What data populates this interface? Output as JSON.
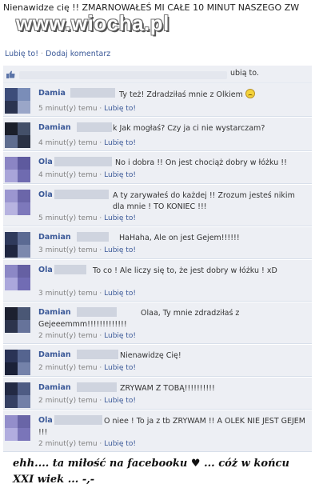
{
  "post": {
    "text": "Nienawidze cię !! ZMARNOWAŁEŚ MI CAŁE 10 MINUT NASZEGO ZW",
    "watermark": "www.wiocha.pl"
  },
  "actions": {
    "like": "Lubię to!",
    "separator": "·",
    "comment": "Dodaj komentarz"
  },
  "likes": {
    "text": "ubią to."
  },
  "comments": [
    {
      "name": "Damia",
      "text": "Ty też! Zdradziłaś mnie z Olkiem",
      "smiley": true,
      "time": "5 minut(y) temu",
      "like": "Lubię to!",
      "colors": [
        "#3d4d7a",
        "#7a8db8",
        "#2b3450",
        "#9aa6c8"
      ]
    },
    {
      "name": "Damian",
      "text": "k Jak mogłaś? Czy ja ci nie wystarczam?",
      "time": "4 minut(y) temu",
      "like": "Lubię to!",
      "colors": [
        "#1b1f2a",
        "#445069",
        "#5f6d8f",
        "#2a3144"
      ]
    },
    {
      "name": "Ola",
      "text": "No i dobra !! On jest chociąż dobry w łóżku !!",
      "time": "4 minut(y) temu",
      "like": "Lubię to!",
      "colors": [
        "#8b85c4",
        "#5e5a9e",
        "#a9a5d9",
        "#6f6bb0"
      ]
    },
    {
      "name": "Ola",
      "text": "A ty zarywałeś do każdej !! Zrozum jesteś nikim dla mnie ! TO KONIEC !!!",
      "time": "5 minut(y) temu",
      "like": "Lubię to!",
      "colors": [
        "#9b96d0",
        "#6b66a9",
        "#b7b3e0",
        "#7d78bb"
      ]
    },
    {
      "name": "Damian",
      "text": "HaHaha, Ale on jest Gejem!!!!!!",
      "time": "3 minut(y) temu",
      "like": "Lubię to!",
      "colors": [
        "#2f3a5c",
        "#5b6a93",
        "#1f2640",
        "#7b88ad"
      ]
    },
    {
      "name": "Ola",
      "text": "To co ! Ale liczy się to, że jest dobry w łóżku ! xD",
      "time": "3 minut(y) temu",
      "like": "Lubię to!",
      "colors": [
        "#8c88c6",
        "#6560a3",
        "#aba7dc",
        "#716cb4"
      ]
    },
    {
      "name": "Damian",
      "text": "Olaa, Ty mnie zdradziłaś z Gejeeemmm!!!!!!!!!!!!!",
      "time": "2 minut(y) temu",
      "like": "Lubię to!",
      "colors": [
        "#1c2030",
        "#4a5775",
        "#2c344c",
        "#66739a"
      ]
    },
    {
      "name": "Damian",
      "text": "Nienawidzę Cię!",
      "time": "2 minut(y) temu",
      "like": "Lubię to!",
      "colors": [
        "#2a3356",
        "#55648f",
        "#1b2138",
        "#7482aa"
      ]
    },
    {
      "name": "Damian",
      "text": "ZRYWAM Z TOBĄ!!!!!!!!!!",
      "time": "2 minut(y) temu",
      "like": "Lubię to!",
      "colors": [
        "#232a44",
        "#4e5c84",
        "#354063",
        "#7280a8"
      ]
    },
    {
      "name": "Ola",
      "text": "O niee ! To ja z tb ZRYWAM !! A OLEK NIE JEST GEJEM !!!",
      "time": "2 minut(y) temu",
      "like": "Lubię to!",
      "colors": [
        "#938ecb",
        "#6965a7",
        "#b1addf",
        "#7a75b9"
      ]
    }
  ],
  "caption": "ehh.... ta miłość na facebooku ♥ ... cóż w końcu XXI wiek ... -,-"
}
